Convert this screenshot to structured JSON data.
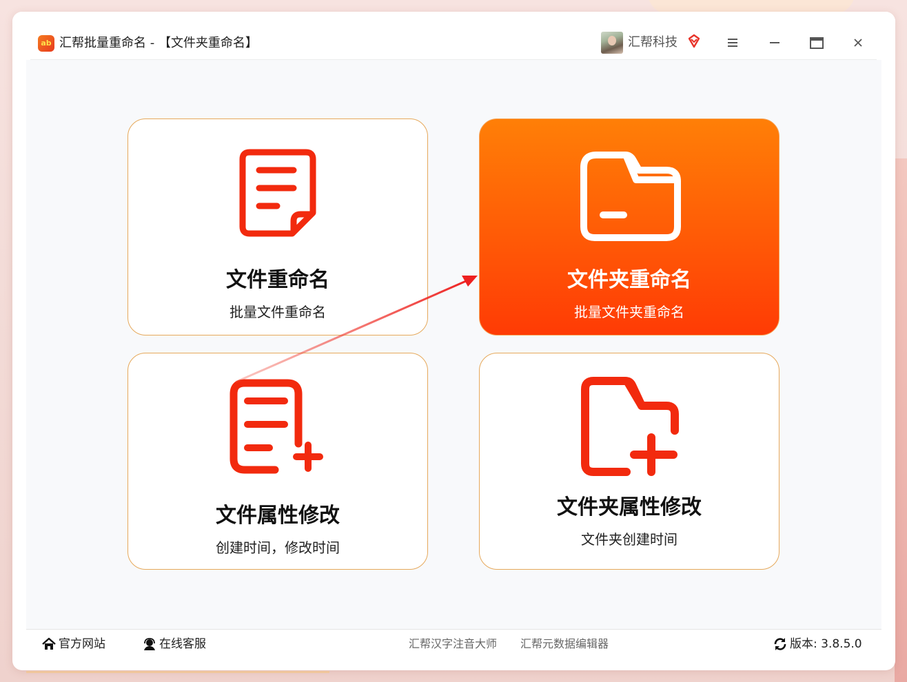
{
  "window": {
    "title": "汇帮批量重命名 - 【文件夹重命名】",
    "logo_text": "ab",
    "company": "汇帮科技",
    "accent_color": "#ff5a06",
    "icon_color": "#f22a0e"
  },
  "cards": [
    {
      "title": "文件重命名",
      "subtitle": "批量文件重命名",
      "icon": "document-icon",
      "active": false
    },
    {
      "title": "文件夹重命名",
      "subtitle": "批量文件夹重命名",
      "icon": "folder-icon",
      "active": true
    },
    {
      "title": "文件属性修改",
      "subtitle": "创建时间，修改时间",
      "icon": "document-add-icon",
      "active": false
    },
    {
      "title": "文件夹属性修改",
      "subtitle": "文件夹创建时间",
      "icon": "folder-add-icon",
      "active": false
    }
  ],
  "footer": {
    "website": "官方网站",
    "support": "在线客服",
    "link_pinyin": "汇帮汉字注音大师",
    "link_metadata": "汇帮元数据编辑器",
    "version_label": "版本:",
    "version": "3.8.5.0"
  }
}
